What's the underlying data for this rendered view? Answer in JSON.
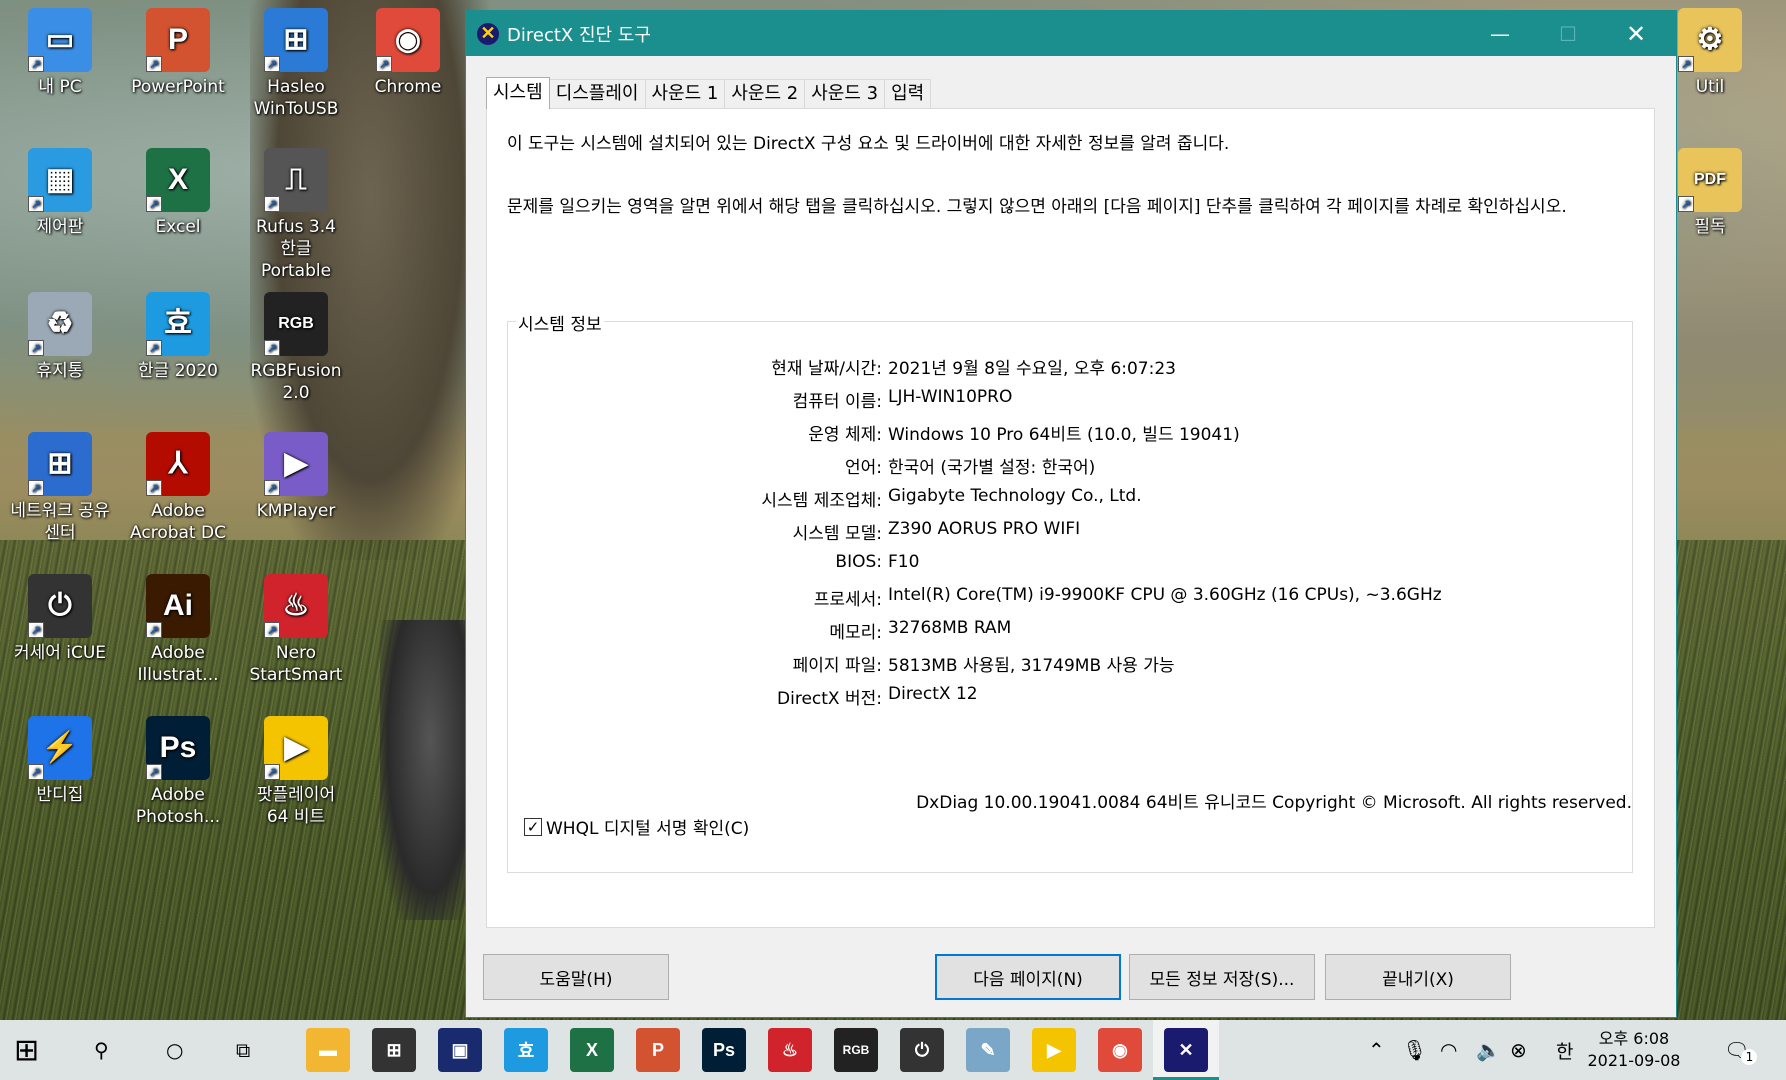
{
  "desktop": {
    "icons": [
      {
        "label": "내 PC",
        "glyph": "▭",
        "color": "#3a8ee6"
      },
      {
        "label": "PowerPoint",
        "glyph": "P",
        "color": "#d35230"
      },
      {
        "label": "Hasleo\nWinToUSB",
        "glyph": "⊞",
        "color": "#2b7bd6"
      },
      {
        "label": "Chrome",
        "glyph": "◉",
        "color": "#e04a3a"
      },
      {
        "label": "제어판",
        "glyph": "▦",
        "color": "#2a9be0"
      },
      {
        "label": "Excel",
        "glyph": "X",
        "color": "#1e7145"
      },
      {
        "label": "Rufus 3.4\n한글 Portable",
        "glyph": "⎍",
        "color": "#555"
      },
      {
        "label": "휴지통",
        "glyph": "♻",
        "color": "#9aa9b5"
      },
      {
        "label": "한글 2020",
        "glyph": "효",
        "color": "#1e9be0"
      },
      {
        "label": "RGBFusion\n2.0",
        "glyph": "RGB",
        "color": "#222"
      },
      {
        "label": "네트워크 공유\n센터",
        "glyph": "⊞",
        "color": "#2c6ccf"
      },
      {
        "label": "Adobe\nAcrobat DC",
        "glyph": "⅄",
        "color": "#b30b00"
      },
      {
        "label": "KMPlayer",
        "glyph": "▶",
        "color": "#7a5cc9"
      },
      {
        "label": "커세어 iCUE",
        "glyph": "⏻",
        "color": "#333"
      },
      {
        "label": "Adobe\nIllustrat...",
        "glyph": "Ai",
        "color": "#3a1a00"
      },
      {
        "label": "Nero\nStartSmart",
        "glyph": "♨",
        "color": "#d0232b"
      },
      {
        "label": "반디집",
        "glyph": "⚡",
        "color": "#1f73e8"
      },
      {
        "label": "Adobe\nPhotosh...",
        "glyph": "Ps",
        "color": "#001e36"
      },
      {
        "label": "팟플레이어\n64 비트",
        "glyph": "▶",
        "color": "#f5c400"
      },
      {
        "label": "Util",
        "glyph": "⚙",
        "color": "#e8c45a"
      },
      {
        "label": "필독",
        "glyph": "PDF",
        "color": "#e8c45a"
      }
    ]
  },
  "dialog": {
    "title": "DirectX 진단 도구",
    "tabs": [
      "시스템",
      "디스플레이",
      "사운드 1",
      "사운드 2",
      "사운드 3",
      "입력"
    ],
    "intro1": "이 도구는 시스템에 설치되어 있는 DirectX 구성 요소 및 드라이버에 대한 자세한 정보를 알려 줍니다.",
    "intro2": "문제를 일으키는 영역을 알면 위에서 해당 탭을 클릭하십시오. 그렇지 않으면 아래의 [다음 페이지] 단추를 클릭하여 각 페이지를 차례로 확인하십시오.",
    "group_title": "시스템 정보",
    "info": [
      {
        "label": "현재 날짜/시간:",
        "value": "2021년 9월 8일 수요일, 오후 6:07:23"
      },
      {
        "label": "컴퓨터 이름:",
        "value": "LJH-WIN10PRO"
      },
      {
        "label": "운영 체제:",
        "value": "Windows 10 Pro 64비트 (10.0, 빌드 19041)"
      },
      {
        "label": "언어:",
        "value": "한국어 (국가별 설정: 한국어)"
      },
      {
        "label": "시스템 제조업체:",
        "value": "Gigabyte Technology Co., Ltd."
      },
      {
        "label": "시스템 모델:",
        "value": "Z390 AORUS PRO WIFI"
      },
      {
        "label": "BIOS:",
        "value": "F10"
      },
      {
        "label": "프로세서:",
        "value": "Intel(R) Core(TM) i9-9900KF CPU @ 3.60GHz (16 CPUs), ~3.6GHz"
      },
      {
        "label": "메모리:",
        "value": "32768MB RAM"
      },
      {
        "label": "페이지 파일:",
        "value": "5813MB 사용됨, 31749MB 사용 가능"
      },
      {
        "label": "DirectX 버전:",
        "value": "DirectX 12"
      }
    ],
    "whql_label": "WHQL 디지털 서명 확인(C)",
    "whql_checked": true,
    "footer": "DxDiag 10.00.19041.0084 64비트 유니코드  Copyright © Microsoft. All rights reserved.",
    "buttons": {
      "help": "도움말(H)",
      "next": "다음 페이지(N)",
      "save": "모든 정보 저장(S)...",
      "exit": "끝내기(X)"
    }
  },
  "taskbar": {
    "apps": [
      {
        "name": "file-explorer",
        "glyph": "▬",
        "color": "#f2b632"
      },
      {
        "name": "store",
        "glyph": "⊞",
        "color": "#333"
      },
      {
        "name": "app-window",
        "glyph": "▣",
        "color": "#1a2a6e"
      },
      {
        "name": "hangul",
        "glyph": "효",
        "color": "#1e9be0"
      },
      {
        "name": "excel",
        "glyph": "X",
        "color": "#1e7145"
      },
      {
        "name": "powerpoint",
        "glyph": "P",
        "color": "#d35230"
      },
      {
        "name": "photoshop",
        "glyph": "Ps",
        "color": "#001e36"
      },
      {
        "name": "nero",
        "glyph": "♨",
        "color": "#d0232b"
      },
      {
        "name": "rgbfusion",
        "glyph": "RGB",
        "color": "#222"
      },
      {
        "name": "icue",
        "glyph": "⏻",
        "color": "#333"
      },
      {
        "name": "notepad",
        "glyph": "✎",
        "color": "#7aa7c7"
      },
      {
        "name": "potplayer",
        "glyph": "▶",
        "color": "#f5c400"
      },
      {
        "name": "chrome",
        "glyph": "◉",
        "color": "#e04a3a"
      },
      {
        "name": "dxdiag",
        "glyph": "✕",
        "color": "#1a1a6e"
      }
    ],
    "ime": "한",
    "clock_time": "오후 6:08",
    "clock_date": "2021-09-08",
    "notification_count": "1"
  }
}
